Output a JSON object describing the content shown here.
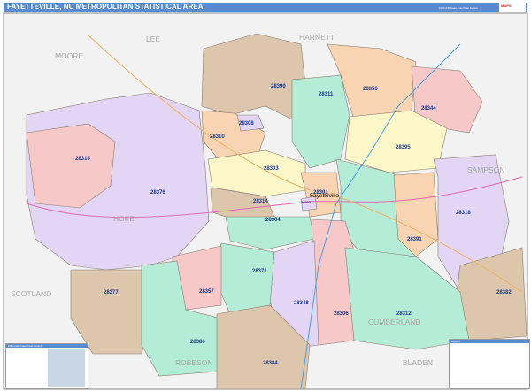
{
  "header": {
    "title": "FAYETTEVILLE, NC METROPOLITAN STATISTICAL AREA",
    "edition": "2020 ZIP Code ColorCast Edition"
  },
  "map": {
    "counties": [
      "LEE",
      "MOORE",
      "HARNETT",
      "HOKE",
      "SAMPSON",
      "SCOTLAND",
      "ROBESON",
      "CUMBERLAND",
      "BLADEN"
    ],
    "city": "Fayetteville",
    "zips": [
      "28390",
      "28311",
      "28356",
      "28344",
      "28308",
      "28310",
      "28395",
      "28315",
      "28303",
      "28376",
      "28301",
      "28314",
      "28305",
      "28304",
      "28318",
      "28391",
      "28357",
      "28371",
      "28382",
      "28377",
      "28348",
      "28306",
      "28312",
      "28386",
      "28384"
    ],
    "colors": {
      "background": "#f2f2f2",
      "title_bar": "#5a8ad0",
      "zip_label": "#1c3a8a",
      "tan": "#dcc6ac",
      "teal": "#b4ecd8",
      "peach": "#f8d4b2",
      "pink": "#f6c8c8",
      "yellow": "#fbf7c9",
      "lavender": "#e3d6f4"
    }
  },
  "legend_left": {
    "title": "ZIP Code Index/Cost Locator"
  },
  "legend_right": {
    "title": "Legend"
  }
}
